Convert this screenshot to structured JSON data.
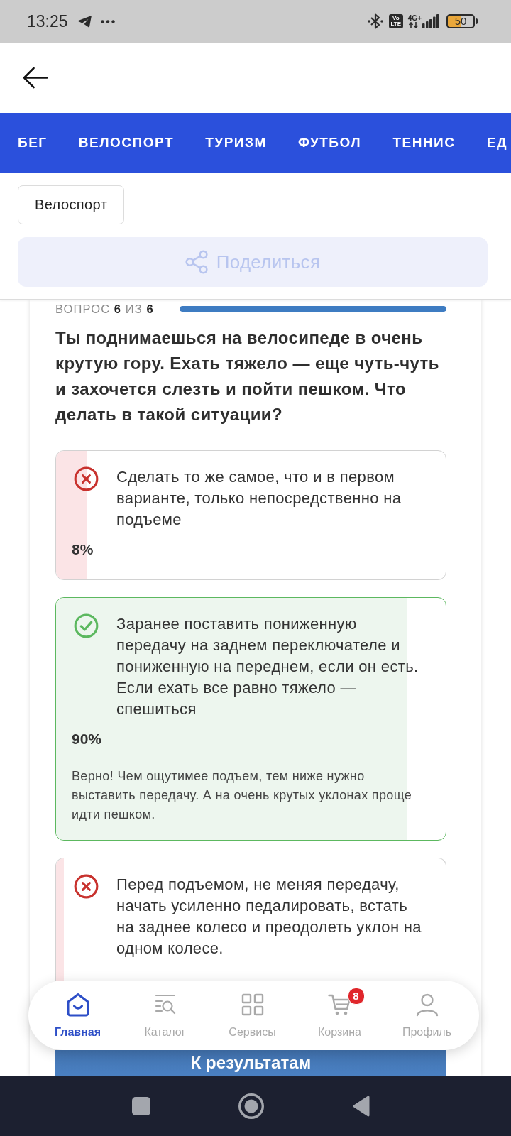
{
  "status_bar": {
    "time": "13:25",
    "volte": "Vo LTE",
    "network": "4G+",
    "battery": "50"
  },
  "categories": [
    "БЕГ",
    "ВЕЛОСПОРТ",
    "ТУРИЗМ",
    "ФУТБОЛ",
    "ТЕННИС",
    "ЕД"
  ],
  "tag": "Велоспорт",
  "share_button": {
    "label": "Поделиться",
    "disabled": true
  },
  "quiz": {
    "progress_label": "ВОПРОС **6** ИЗ **6**",
    "progress": {
      "level": 1
    },
    "question": "Ты поднимаешься на велосипеде в очень крутую гору. Ехать тяжело — еще чуть-чуть и захочется слезть и пойти пешком. Что делать в такой ситуации?",
    "answers": [
      {
        "text": "Сделать то же самое, что и в первом варианте, только непосредственно на подъеме",
        "correct": false,
        "level": 0.08,
        "percent": "8%"
      },
      {
        "text": "Заранее поставить пониженную передачу на заднем переключателе и пониженную на переднем, если он есть. Если ехать все равно тяжело — спешиться",
        "correct": true,
        "level": 0.9,
        "percent": "90%",
        "explanation": "Верно! Чем ощутимее подъем, тем ниже нужно выставить передачу. А на очень крутых уклонах проще идти пешком."
      },
      {
        "text": "Перед подъемом, не меняя передачу, начать усиленно педалировать, встать на заднее колесо и преодолеть уклон на одном колесе.",
        "correct": false,
        "level": 0.02
      }
    ],
    "results_button": "К результатам"
  },
  "bottom_nav": [
    {
      "label": "Главная",
      "selected": true
    },
    {
      "label": "Каталог",
      "selected": false
    },
    {
      "label": "Сервисы",
      "selected": false
    },
    {
      "label": "Корзина",
      "selected": false,
      "badge": "8"
    },
    {
      "label": "Профиль",
      "selected": false
    }
  ]
}
